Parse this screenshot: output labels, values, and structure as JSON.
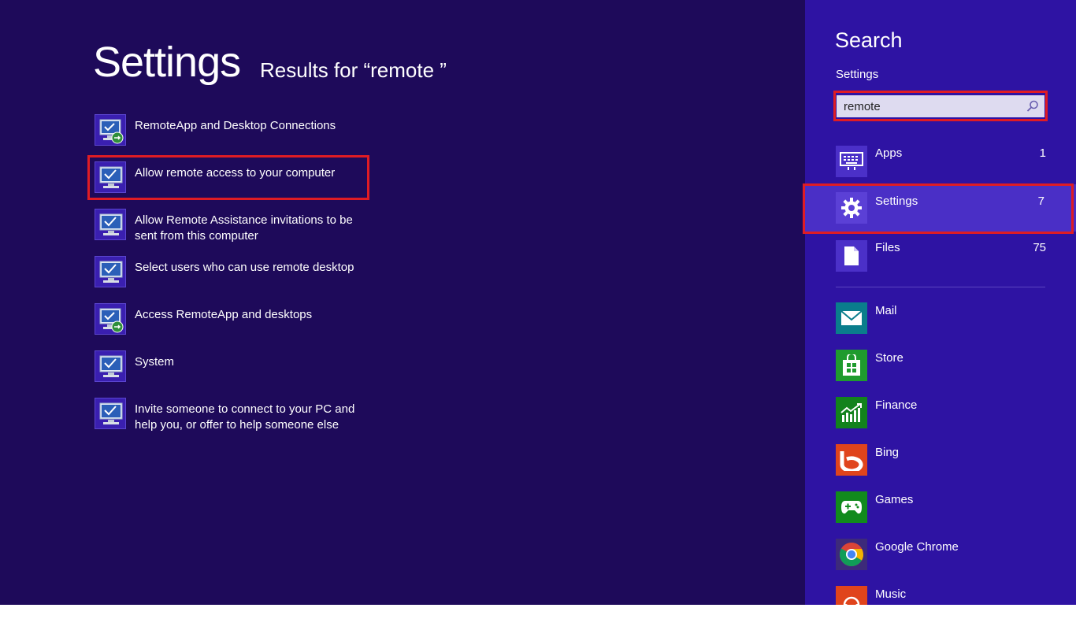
{
  "results": {
    "title": "Settings",
    "subtitle": "Results for “remote ”",
    "items": [
      {
        "label": "RemoteApp and Desktop Connections",
        "icon": "remote-connection-icon"
      },
      {
        "label": "Allow remote access to your computer",
        "icon": "system-monitor-icon"
      },
      {
        "label": "Allow Remote Assistance invitations to be sent from this computer",
        "icon": "system-monitor-icon"
      },
      {
        "label": "Select users who can use remote desktop",
        "icon": "system-monitor-icon"
      },
      {
        "label": "Access RemoteApp and desktops",
        "icon": "remote-connection-icon"
      },
      {
        "label": "System",
        "icon": "system-monitor-icon"
      },
      {
        "label": "Invite someone to connect to your PC and help you, or offer to help someone else",
        "icon": "system-monitor-icon"
      }
    ]
  },
  "charm": {
    "title": "Search",
    "scope": "Settings",
    "search": {
      "value": "remote",
      "placeholder": ""
    },
    "scopes": [
      {
        "label": "Apps",
        "count": "1",
        "icon": "apps-keyboard-icon"
      },
      {
        "label": "Settings",
        "count": "7",
        "icon": "gear-icon"
      },
      {
        "label": "Files",
        "count": "75",
        "icon": "file-icon"
      }
    ],
    "apps": [
      {
        "label": "Mail",
        "icon": "mail-icon",
        "color": "#0a7d8c"
      },
      {
        "label": "Store",
        "icon": "store-icon",
        "color": "#1f9b2e"
      },
      {
        "label": "Finance",
        "icon": "finance-icon",
        "color": "#12821c"
      },
      {
        "label": "Bing",
        "icon": "bing-icon",
        "color": "#e0441c"
      },
      {
        "label": "Games",
        "icon": "games-icon",
        "color": "#118a1d"
      },
      {
        "label": "Google Chrome",
        "icon": "chrome-icon",
        "color": "#3d2a7a"
      },
      {
        "label": "Music",
        "icon": "music-icon",
        "color": "#e0441c"
      }
    ]
  },
  "colors": {
    "background": "#1e0a5a",
    "charm_background": "#2e13a3",
    "highlight": "#e01c24",
    "selected_scope": "#4a2fc6"
  }
}
